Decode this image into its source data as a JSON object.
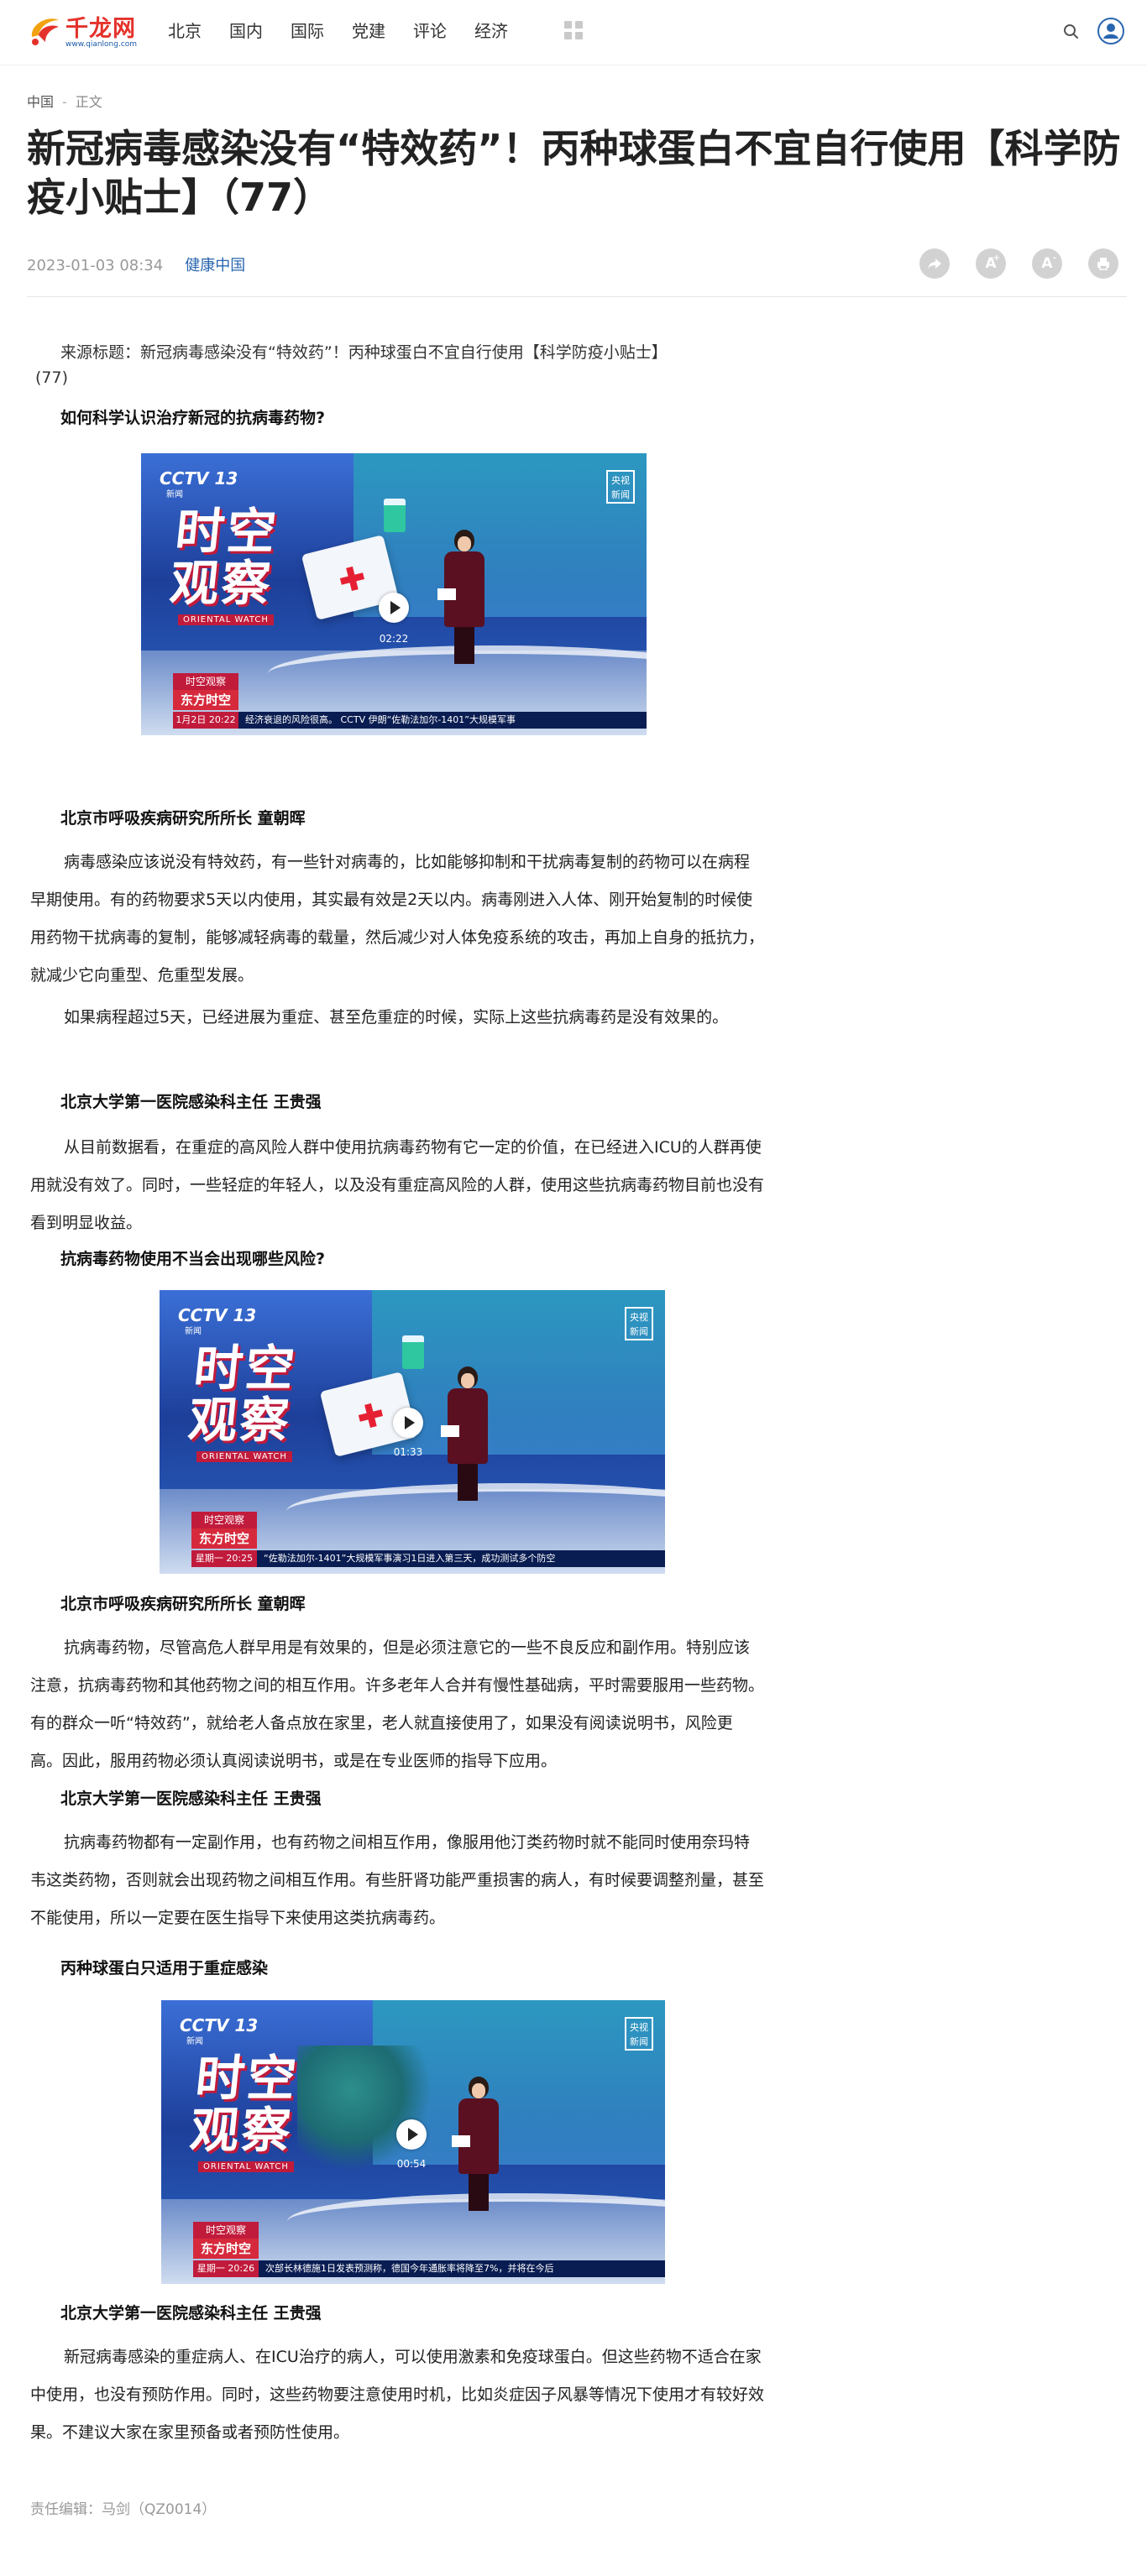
{
  "site": {
    "logo_text": "千龙网",
    "logo_sub": "www.qianlong.com",
    "nav": [
      "北京",
      "国内",
      "国际",
      "党建",
      "评论",
      "经济"
    ]
  },
  "breadcrumb": {
    "section": "中国",
    "separator": "-",
    "current": "正文"
  },
  "article": {
    "title": "新冠病毒感染没有“特效药”！丙种球蛋白不宜自行使用【科学防疫小贴士】（77）",
    "datetime": "2023-01-03 08:34",
    "source": "健康中国",
    "tools": [
      "share-icon",
      "font-larger-icon",
      "font-smaller-icon",
      "print-icon"
    ],
    "lead_line1": "来源标题：新冠病毒感染没有“特效药”！丙种球蛋白不宜自行使用【科学防疫小贴士】",
    "lead_line2": "(77)",
    "q1": "如何科学认识治疗新冠的抗病毒药物?",
    "video1": {
      "duration": "02:22",
      "channel": "CCTV 13",
      "channel_sub": "新闻",
      "show_title": "时空观察",
      "show_en": "ORIENTAL WATCH",
      "badge": "央视新闻",
      "lower1": "时空观察",
      "lower2": "东方时空",
      "ticker_date": "1月2日  20:22",
      "ticker": "经济衰退的风险很高。  CCTV 伊朗“佐勒法加尔-1401”大规模军事"
    },
    "speaker1": "北京市呼吸疾病研究所所长 童朝晖",
    "p1": "病毒感染应该说没有特效药，有一些针对病毒的，比如能够抑制和干扰病毒复制的药物可以在病程早期使用。有的药物要求5天以内使用，其实最有效是2天以内。病毒刚进入人体、刚开始复制的时候使用药物干扰病毒的复制，能够减轻病毒的载量，然后减少对人体免疫系统的攻击，再加上自身的抵抗力，就减少它向重型、危重型发展。",
    "p2": "如果病程超过5天，已经进展为重症、甚至危重症的时候，实际上这些抗病毒药是没有效果的。",
    "speaker2": "北京大学第一医院感染科主任 王贵强",
    "p3": "从目前数据看，在重症的高风险人群中使用抗病毒药物有它一定的价值，在已经进入ICU的人群再使用就没有效了。同时，一些轻症的年轻人，以及没有重症高风险的人群，使用这些抗病毒药物目前也没有看到明显收益。",
    "q2": "抗病毒药物使用不当会出现哪些风险?",
    "video2": {
      "duration": "01:33",
      "channel": "CCTV 13",
      "channel_sub": "新闻",
      "show_title": "时空观察",
      "show_en": "ORIENTAL WATCH",
      "badge": "央视新闻",
      "lower1": "时空观察",
      "lower2": "东方时空",
      "ticker_date": "星期一  20:25",
      "ticker": "“佐勒法加尔-1401”大规模军事演习1日进入第三天，成功测试多个防空"
    },
    "speaker3": "北京市呼吸疾病研究所所长 童朝晖",
    "p4": "抗病毒药物，尽管高危人群早用是有效果的，但是必须注意它的一些不良反应和副作用。特别应该注意，抗病毒药物和其他药物之间的相互作用。许多老年人合并有慢性基础病，平时需要服用一些药物。有的群众一听“特效药”，就给老人备点放在家里，老人就直接使用了，如果没有阅读说明书，风险更高。因此，服用药物必须认真阅读说明书，或是在专业医师的指导下应用。",
    "speaker4": "北京大学第一医院感染科主任 王贵强",
    "p5": "抗病毒药物都有一定副作用，也有药物之间相互作用，像服用他汀类药物时就不能同时使用奈玛特韦这类药物，否则就会出现药物之间相互作用。有些肝肾功能严重损害的病人，有时候要调整剂量，甚至不能使用，所以一定要在医生指导下来使用这类抗病毒药。",
    "q3": "丙种球蛋白只适用于重症感染",
    "video3": {
      "duration": "00:54",
      "channel": "CCTV 13",
      "channel_sub": "新闻",
      "show_title": "时空观察",
      "show_en": "ORIENTAL WATCH",
      "badge": "央视新闻",
      "lower1": "时空观察",
      "lower2": "东方时空",
      "ticker_date": "星期一  20:26",
      "ticker": "次部长林德施1日发表预测称，德国今年通胀率将降至7%，并将在今后"
    },
    "speaker5": "北京大学第一医院感染科主任 王贵强",
    "p6": "新冠病毒感染的重症病人、在ICU治疗的病人，可以使用激素和免疫球蛋白。但这些药物不适合在家中使用，也没有预防作用。同时，这些药物要注意使用时机，比如炎症因子风暴等情况下使用才有较好效果。不建议大家在家里预备或者预防性使用。",
    "editor": "责任编辑：马剑（QZ0014）"
  },
  "colors": {
    "brand_red": "#e4322b",
    "link_blue": "#2a66b0",
    "tool_gray": "#d2d2d2"
  }
}
